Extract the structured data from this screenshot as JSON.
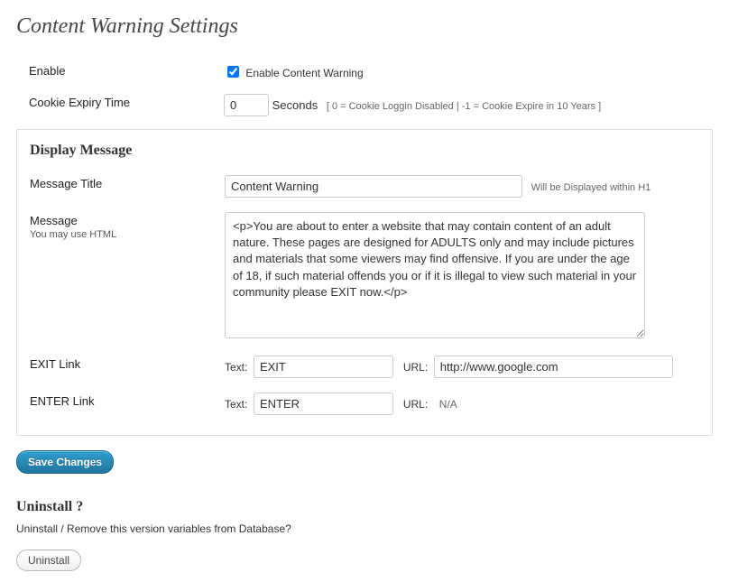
{
  "page": {
    "title": "Content Warning Settings"
  },
  "enable": {
    "label": "Enable",
    "checkbox_label": "Enable Content Warning",
    "checked": true
  },
  "cookie": {
    "label": "Cookie Expiry Time",
    "value": "0",
    "unit": "Seconds",
    "hint": "[ 0 = Cookie Loggin Disabled | -1 = Cookie Expire in 10 Years ]"
  },
  "display": {
    "heading": "Display Message",
    "title_label": "Message Title",
    "title_value": "Content Warning",
    "title_hint": "Will be Displayed within H1",
    "message_label": "Message",
    "message_sub": "You may use HTML",
    "message_value": "<p>You are about to enter a website that may contain content of an adult nature. These pages are designed for ADULTS only and may include pictures and materials that some viewers may find offensive. If you are under the age of 18, if such material offends you or if it is illegal to view such material in your community please EXIT now.</p>",
    "exit_label": "EXIT Link",
    "exit_text_label": "Text:",
    "exit_text_value": "EXIT",
    "exit_url_label": "URL:",
    "exit_url_value": "http://www.google.com",
    "enter_label": "ENTER Link",
    "enter_text_label": "Text:",
    "enter_text_value": "ENTER",
    "enter_url_label": "URL:",
    "enter_url_value": "N/A"
  },
  "save": {
    "label": "Save Changes"
  },
  "uninstall": {
    "heading": "Uninstall ?",
    "desc": "Uninstall / Remove this version variables from Database?",
    "button": "Uninstall"
  }
}
